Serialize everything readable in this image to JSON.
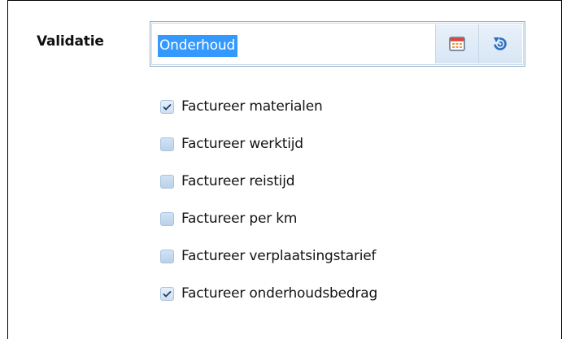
{
  "validation": {
    "label": "Validatie",
    "value": "Onderhoud",
    "buttons": {
      "calendar_icon": "calendar-icon",
      "refresh_icon": "refresh-icon"
    }
  },
  "options": [
    {
      "label": "Factureer materialen",
      "checked": true
    },
    {
      "label": "Factureer werktijd",
      "checked": false
    },
    {
      "label": "Factureer reistijd",
      "checked": false
    },
    {
      "label": "Factureer per km",
      "checked": false
    },
    {
      "label": "Factureer verplaatsingstarief",
      "checked": false
    },
    {
      "label": "Factureer onderhoudsbedrag",
      "checked": true
    }
  ],
  "colors": {
    "selection": "#3399ff",
    "checkmark": "#1e3f66",
    "border": "#8eaecb"
  }
}
